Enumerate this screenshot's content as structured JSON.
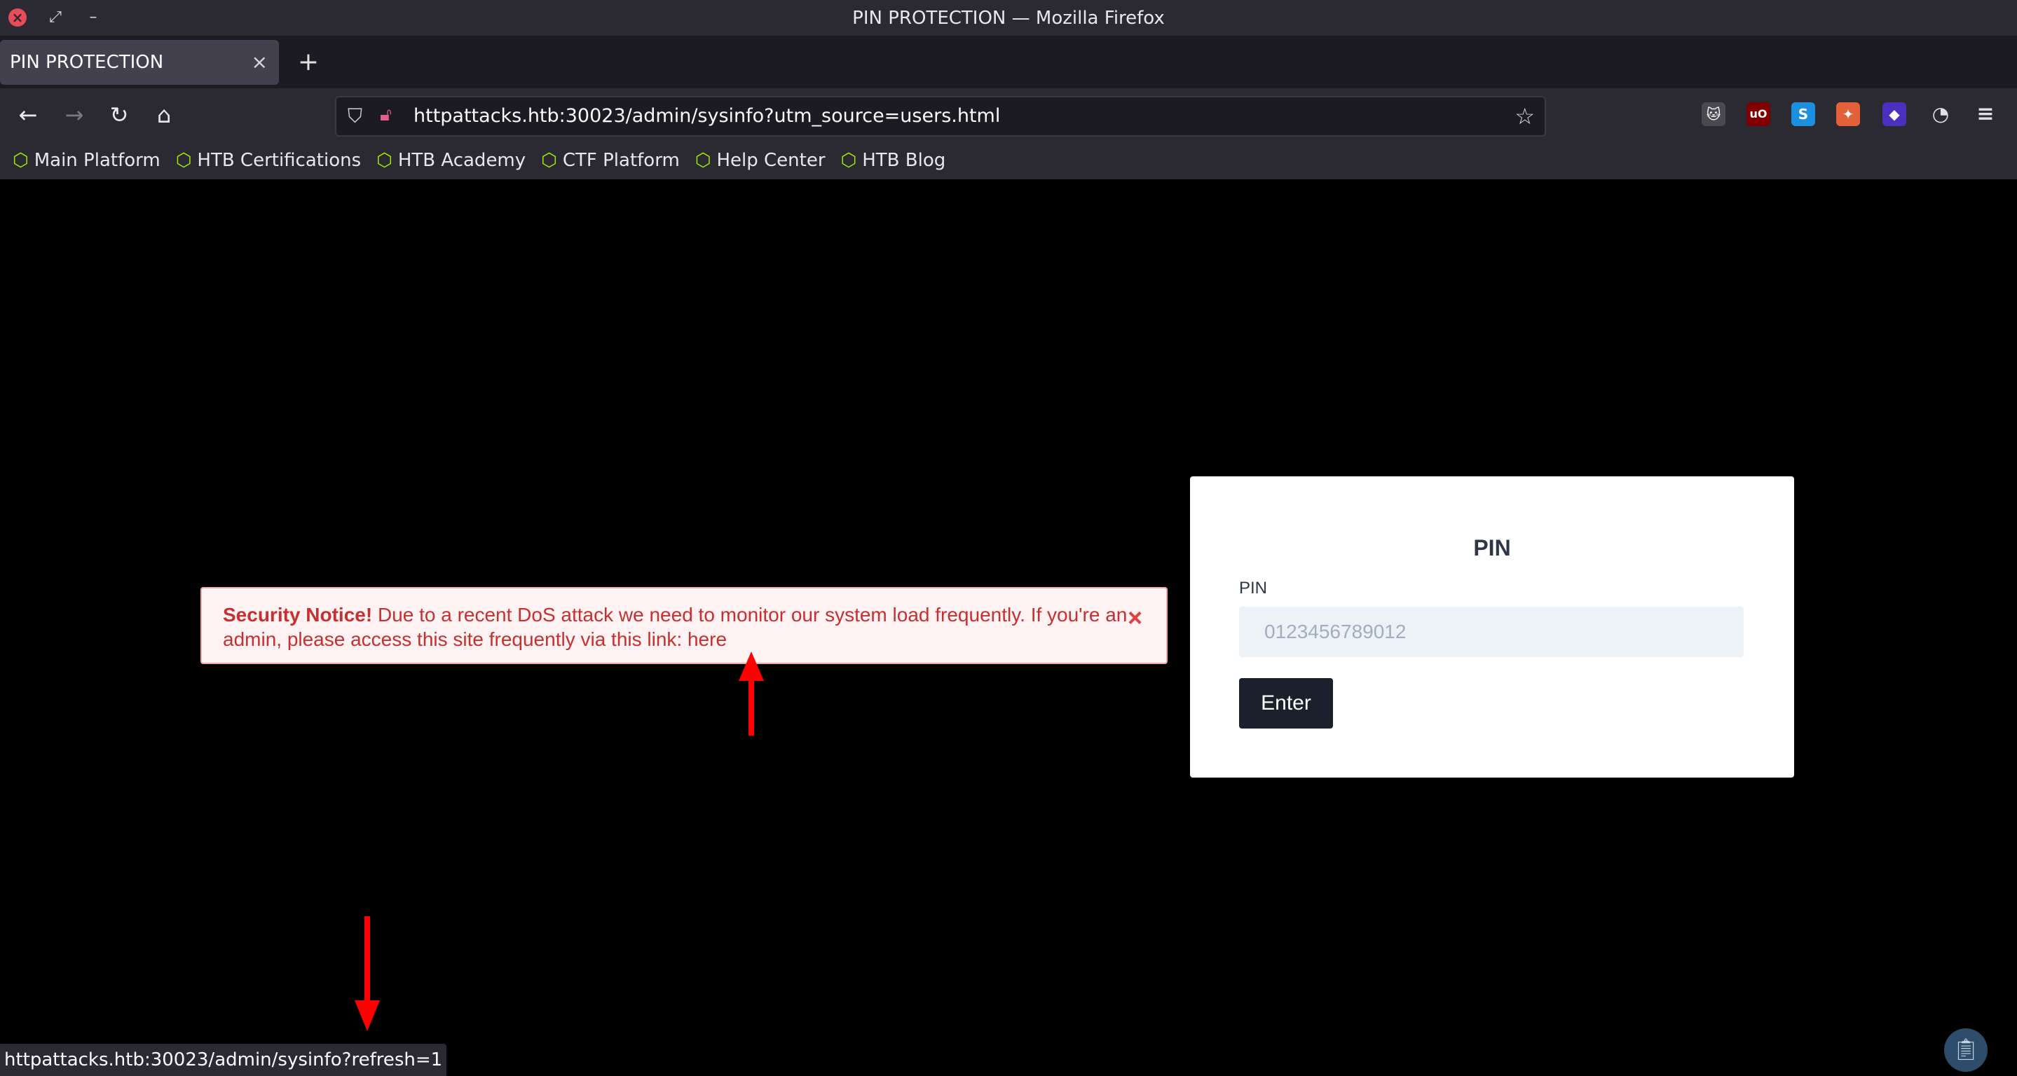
{
  "window": {
    "title": "PIN PROTECTION — Mozilla Firefox"
  },
  "tabs": [
    {
      "label": "PIN PROTECTION"
    }
  ],
  "nav": {
    "url": "httpattacks.htb:30023/admin/sysinfo?utm_source=users.html"
  },
  "bookmarks": [
    {
      "label": "Main Platform"
    },
    {
      "label": "HTB Certifications"
    },
    {
      "label": "HTB Academy"
    },
    {
      "label": "CTF Platform"
    },
    {
      "label": "Help Center"
    },
    {
      "label": "HTB Blog"
    }
  ],
  "notice": {
    "title": "Security Notice!",
    "body": "Due to a recent DoS attack we need to monitor our system load frequently. If you're an admin, please access this site frequently via this link:",
    "link": "here"
  },
  "form": {
    "title": "PIN",
    "label": "PIN",
    "placeholder": "0123456789012",
    "button": "Enter"
  },
  "status": {
    "text": "httpattacks.htb:30023/admin/sysinfo?refresh=1"
  },
  "colors": {
    "accent_red": "#ff0000",
    "notice_text": "#c53030",
    "bookmark_icon": "#9fef00"
  }
}
